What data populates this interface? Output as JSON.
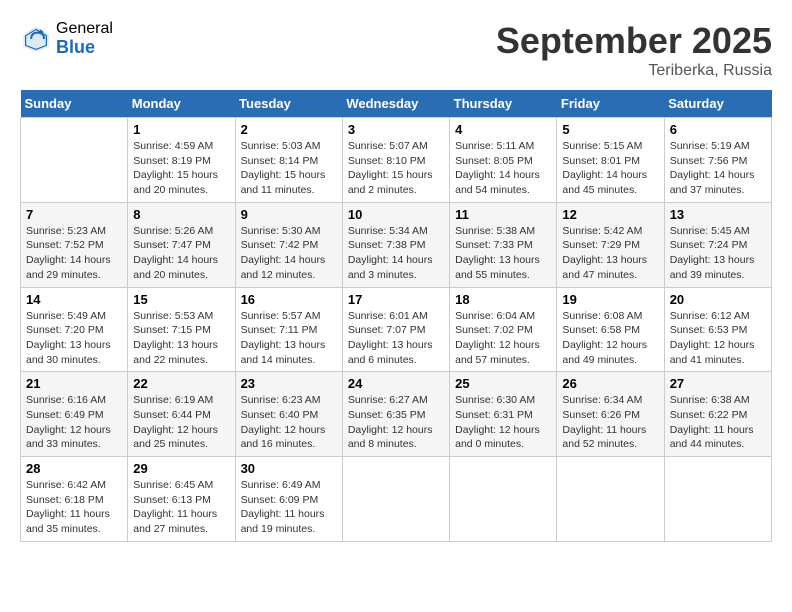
{
  "header": {
    "logo_general": "General",
    "logo_blue": "Blue",
    "month_title": "September 2025",
    "location": "Teriberka, Russia"
  },
  "days_of_week": [
    "Sunday",
    "Monday",
    "Tuesday",
    "Wednesday",
    "Thursday",
    "Friday",
    "Saturday"
  ],
  "weeks": [
    [
      {
        "day": "",
        "info": ""
      },
      {
        "day": "1",
        "info": "Sunrise: 4:59 AM\nSunset: 8:19 PM\nDaylight: 15 hours\nand 20 minutes."
      },
      {
        "day": "2",
        "info": "Sunrise: 5:03 AM\nSunset: 8:14 PM\nDaylight: 15 hours\nand 11 minutes."
      },
      {
        "day": "3",
        "info": "Sunrise: 5:07 AM\nSunset: 8:10 PM\nDaylight: 15 hours\nand 2 minutes."
      },
      {
        "day": "4",
        "info": "Sunrise: 5:11 AM\nSunset: 8:05 PM\nDaylight: 14 hours\nand 54 minutes."
      },
      {
        "day": "5",
        "info": "Sunrise: 5:15 AM\nSunset: 8:01 PM\nDaylight: 14 hours\nand 45 minutes."
      },
      {
        "day": "6",
        "info": "Sunrise: 5:19 AM\nSunset: 7:56 PM\nDaylight: 14 hours\nand 37 minutes."
      }
    ],
    [
      {
        "day": "7",
        "info": "Sunrise: 5:23 AM\nSunset: 7:52 PM\nDaylight: 14 hours\nand 29 minutes."
      },
      {
        "day": "8",
        "info": "Sunrise: 5:26 AM\nSunset: 7:47 PM\nDaylight: 14 hours\nand 20 minutes."
      },
      {
        "day": "9",
        "info": "Sunrise: 5:30 AM\nSunset: 7:42 PM\nDaylight: 14 hours\nand 12 minutes."
      },
      {
        "day": "10",
        "info": "Sunrise: 5:34 AM\nSunset: 7:38 PM\nDaylight: 14 hours\nand 3 minutes."
      },
      {
        "day": "11",
        "info": "Sunrise: 5:38 AM\nSunset: 7:33 PM\nDaylight: 13 hours\nand 55 minutes."
      },
      {
        "day": "12",
        "info": "Sunrise: 5:42 AM\nSunset: 7:29 PM\nDaylight: 13 hours\nand 47 minutes."
      },
      {
        "day": "13",
        "info": "Sunrise: 5:45 AM\nSunset: 7:24 PM\nDaylight: 13 hours\nand 39 minutes."
      }
    ],
    [
      {
        "day": "14",
        "info": "Sunrise: 5:49 AM\nSunset: 7:20 PM\nDaylight: 13 hours\nand 30 minutes."
      },
      {
        "day": "15",
        "info": "Sunrise: 5:53 AM\nSunset: 7:15 PM\nDaylight: 13 hours\nand 22 minutes."
      },
      {
        "day": "16",
        "info": "Sunrise: 5:57 AM\nSunset: 7:11 PM\nDaylight: 13 hours\nand 14 minutes."
      },
      {
        "day": "17",
        "info": "Sunrise: 6:01 AM\nSunset: 7:07 PM\nDaylight: 13 hours\nand 6 minutes."
      },
      {
        "day": "18",
        "info": "Sunrise: 6:04 AM\nSunset: 7:02 PM\nDaylight: 12 hours\nand 57 minutes."
      },
      {
        "day": "19",
        "info": "Sunrise: 6:08 AM\nSunset: 6:58 PM\nDaylight: 12 hours\nand 49 minutes."
      },
      {
        "day": "20",
        "info": "Sunrise: 6:12 AM\nSunset: 6:53 PM\nDaylight: 12 hours\nand 41 minutes."
      }
    ],
    [
      {
        "day": "21",
        "info": "Sunrise: 6:16 AM\nSunset: 6:49 PM\nDaylight: 12 hours\nand 33 minutes."
      },
      {
        "day": "22",
        "info": "Sunrise: 6:19 AM\nSunset: 6:44 PM\nDaylight: 12 hours\nand 25 minutes."
      },
      {
        "day": "23",
        "info": "Sunrise: 6:23 AM\nSunset: 6:40 PM\nDaylight: 12 hours\nand 16 minutes."
      },
      {
        "day": "24",
        "info": "Sunrise: 6:27 AM\nSunset: 6:35 PM\nDaylight: 12 hours\nand 8 minutes."
      },
      {
        "day": "25",
        "info": "Sunrise: 6:30 AM\nSunset: 6:31 PM\nDaylight: 12 hours\nand 0 minutes."
      },
      {
        "day": "26",
        "info": "Sunrise: 6:34 AM\nSunset: 6:26 PM\nDaylight: 11 hours\nand 52 minutes."
      },
      {
        "day": "27",
        "info": "Sunrise: 6:38 AM\nSunset: 6:22 PM\nDaylight: 11 hours\nand 44 minutes."
      }
    ],
    [
      {
        "day": "28",
        "info": "Sunrise: 6:42 AM\nSunset: 6:18 PM\nDaylight: 11 hours\nand 35 minutes."
      },
      {
        "day": "29",
        "info": "Sunrise: 6:45 AM\nSunset: 6:13 PM\nDaylight: 11 hours\nand 27 minutes."
      },
      {
        "day": "30",
        "info": "Sunrise: 6:49 AM\nSunset: 6:09 PM\nDaylight: 11 hours\nand 19 minutes."
      },
      {
        "day": "",
        "info": ""
      },
      {
        "day": "",
        "info": ""
      },
      {
        "day": "",
        "info": ""
      },
      {
        "day": "",
        "info": ""
      }
    ]
  ]
}
